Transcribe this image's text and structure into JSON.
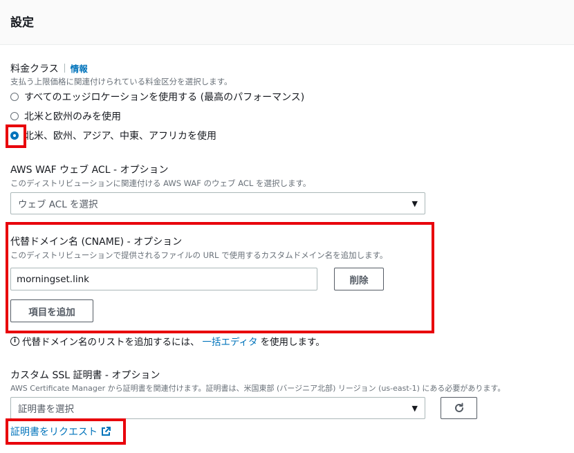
{
  "header": {
    "title": "設定"
  },
  "price_class": {
    "label": "料金クラス",
    "info": "情報",
    "description": "支払う上限価格に関連付けられている料金区分を選択します。",
    "options": [
      {
        "label": "すべてのエッジロケーションを使用する (最高のパフォーマンス)",
        "selected": false
      },
      {
        "label": "北米と欧州のみを使用",
        "selected": false
      },
      {
        "label": "北米、欧州、アジア、中東、アフリカを使用",
        "selected": true
      }
    ]
  },
  "waf": {
    "label": "AWS WAF ウェブ ACL - オプション",
    "description": "このディストリビューションに関連付ける AWS WAF のウェブ ACL を選択します。",
    "placeholder": "ウェブ ACL を選択"
  },
  "cname": {
    "label": "代替ドメイン名 (CNAME) - オプション",
    "description": "このディストリビューションで提供されるファイルの URL で使用するカスタムドメイン名を追加します。",
    "value": "morningset.link",
    "remove_label": "削除",
    "add_label": "項目を追加",
    "hint_prefix": "代替ドメイン名のリストを追加するには、",
    "hint_link": "一括エディタ",
    "hint_suffix": "を使用します。"
  },
  "ssl": {
    "label": "カスタム SSL 証明書 - オプション",
    "description": "AWS Certificate Manager から証明書を関連付けます。証明書は、米国東部 (バージニア北部) リージョン (us-east-1) にある必要があります。",
    "placeholder": "証明書を選択",
    "request_link": "証明書をリクエスト"
  },
  "colors": {
    "accent": "#0073bb",
    "highlight": "#e8000b"
  }
}
